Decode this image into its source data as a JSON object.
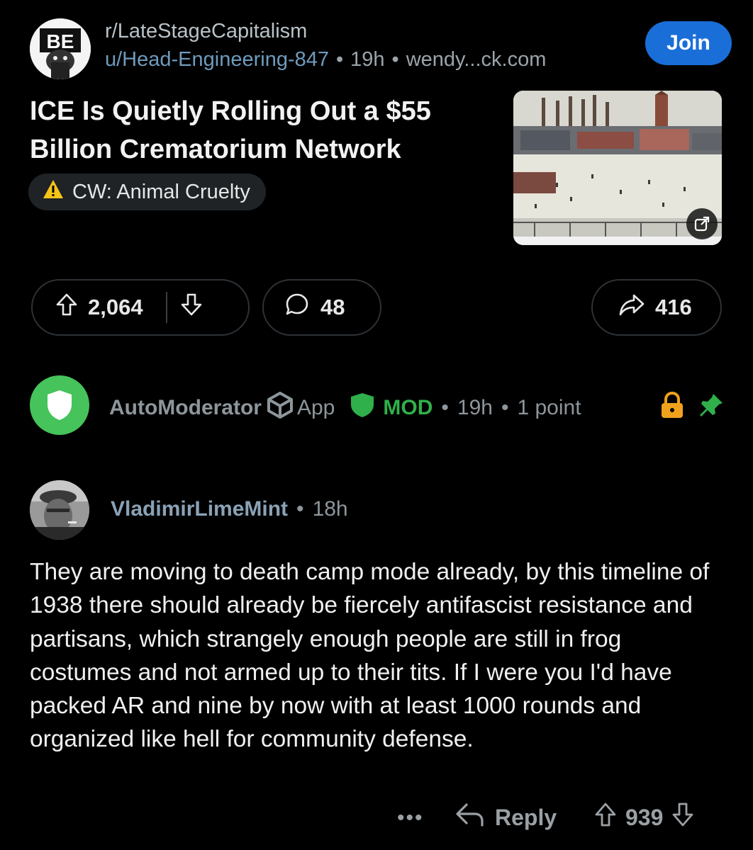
{
  "post": {
    "subreddit": "r/LateStageCapitalism",
    "author": "u/Head-Engineering-847",
    "age": "19h",
    "domain": "wendy...ck.com",
    "join_label": "Join",
    "title": "ICE Is Quietly Rolling Out a $55 Billion Crematorium Network",
    "flair": "CW: Animal Cruelty",
    "upvotes": "2,064",
    "comments": "48",
    "shares": "416"
  },
  "automod": {
    "name": "AutoModerator",
    "app_label": "App",
    "mod_label": "MOD",
    "age": "19h",
    "points": "1 point"
  },
  "comment": {
    "author": "VladimirLimeMint",
    "age": "18h",
    "body": "They are moving to death camp mode already, by this timeline of 1938 there should already be fiercely antifascist resistance and partisans, which strangely enough people are still in frog costumes and not armed up to their tits. If I were you I'd have packed AR and nine by now with at least 1000 rounds and organized like hell for community defense.",
    "more_label": "•••",
    "reply_label": "Reply",
    "score": "939"
  },
  "colors": {
    "join": "#1a6ed8",
    "mod_green": "#2fb04a",
    "automod_avatar": "#46c35a",
    "lock": "#f0a21c"
  }
}
